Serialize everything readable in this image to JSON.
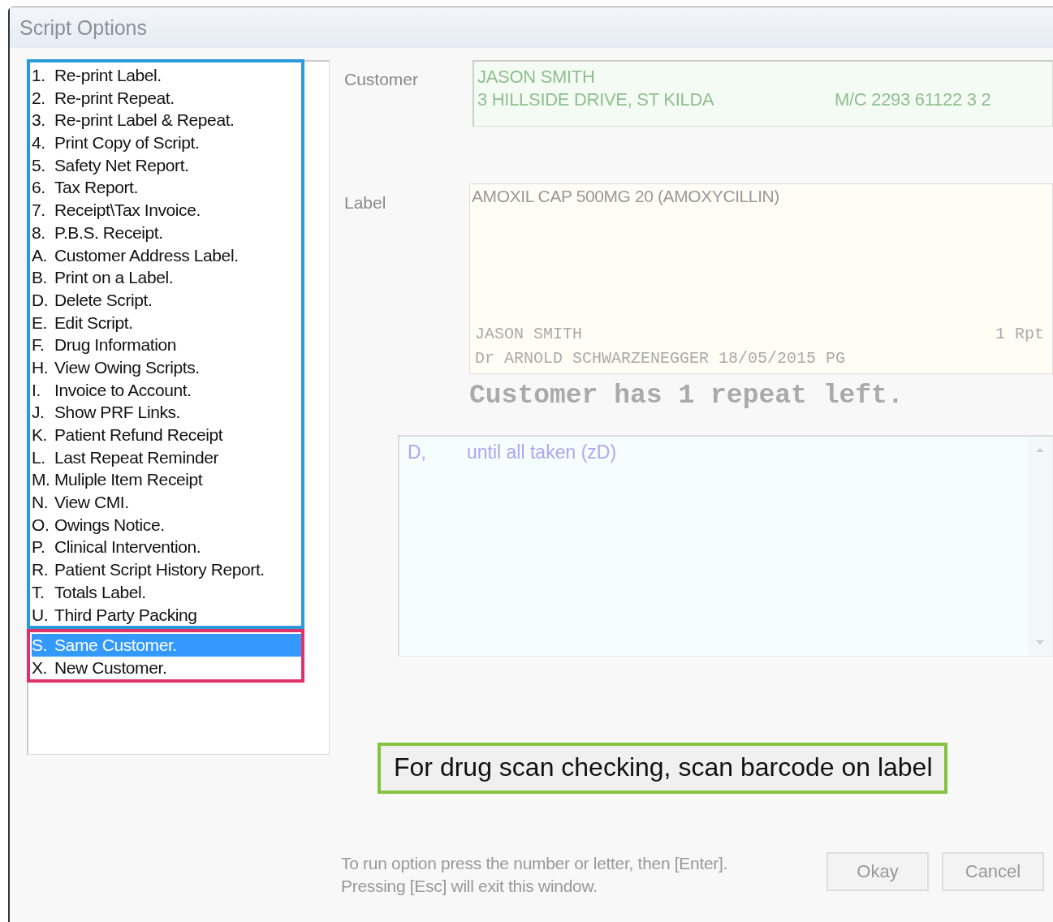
{
  "window": {
    "title": "Script Options"
  },
  "option_groups": [
    {
      "color": "#2b9ad9",
      "items": [
        {
          "key": "1.",
          "label": "Re-print Label.",
          "selected": false
        },
        {
          "key": "2.",
          "label": "Re-print Repeat.",
          "selected": false
        },
        {
          "key": "3.",
          "label": "Re-print Label & Repeat.",
          "selected": false
        },
        {
          "key": "4.",
          "label": "Print Copy of Script.",
          "selected": false
        },
        {
          "key": "5.",
          "label": "Safety Net Report.",
          "selected": false
        },
        {
          "key": "6.",
          "label": "Tax Report.",
          "selected": false
        },
        {
          "key": "7.",
          "label": "Receipt\\Tax Invoice.",
          "selected": false
        },
        {
          "key": "8.",
          "label": "P.B.S. Receipt.",
          "selected": false
        },
        {
          "key": "A.",
          "label": "Customer Address Label.",
          "selected": false
        },
        {
          "key": "B.",
          "label": "Print on a Label.",
          "selected": false
        },
        {
          "key": "D.",
          "label": "Delete Script.",
          "selected": false
        },
        {
          "key": "E.",
          "label": "Edit Script.",
          "selected": false
        },
        {
          "key": "F.",
          "label": "Drug Information",
          "selected": false
        },
        {
          "key": "H.",
          "label": "View Owing Scripts.",
          "selected": false
        },
        {
          "key": "I.",
          "label": "Invoice to Account.",
          "selected": false
        },
        {
          "key": "J.",
          "label": "Show PRF Links.",
          "selected": false
        },
        {
          "key": "K.",
          "label": "Patient Refund Receipt",
          "selected": false
        },
        {
          "key": "L.",
          "label": "Last Repeat Reminder",
          "selected": false
        },
        {
          "key": "M.",
          "label": "Muliple Item Receipt",
          "selected": false
        },
        {
          "key": "N.",
          "label": "View CMI.",
          "selected": false
        },
        {
          "key": "O.",
          "label": "Owings Notice.",
          "selected": false
        },
        {
          "key": "P.",
          "label": "Clinical Intervention.",
          "selected": false
        },
        {
          "key": "R.",
          "label": "Patient Script History Report.",
          "selected": false
        },
        {
          "key": "T.",
          "label": "Totals Label.",
          "selected": false
        },
        {
          "key": "U.",
          "label": "Third Party Packing",
          "selected": false
        }
      ]
    },
    {
      "color": "#e0326a",
      "items": [
        {
          "key": "S.",
          "label": "Same Customer.",
          "selected": true
        },
        {
          "key": "X.",
          "label": "New Customer.",
          "selected": false
        }
      ]
    }
  ],
  "customer": {
    "label": "Customer",
    "name": "JASON SMITH",
    "address": "3 HILLSIDE DRIVE, ST KILDA",
    "medicare": "M/C 2293 61122 3 2"
  },
  "label": {
    "label": "Label",
    "drug": "AMOXIL CAP 500MG 20 (AMOXYCILLIN)",
    "patient": "JASON SMITH",
    "repeats": "1 Rpt",
    "doctor_line": "Dr ARNOLD SCHWARZENEGGER 18/05/2015 PG"
  },
  "repeat_notice": "Customer has 1 repeat left.",
  "directions": {
    "code": "D,",
    "text": "until all taken (zD)"
  },
  "scan_hint": "For drug scan checking, scan barcode on label",
  "instructions": [
    "To run option press the number or letter, then [Enter].",
    "Pressing [Esc] will exit this window."
  ],
  "buttons": [
    "Okay",
    "Cancel"
  ]
}
